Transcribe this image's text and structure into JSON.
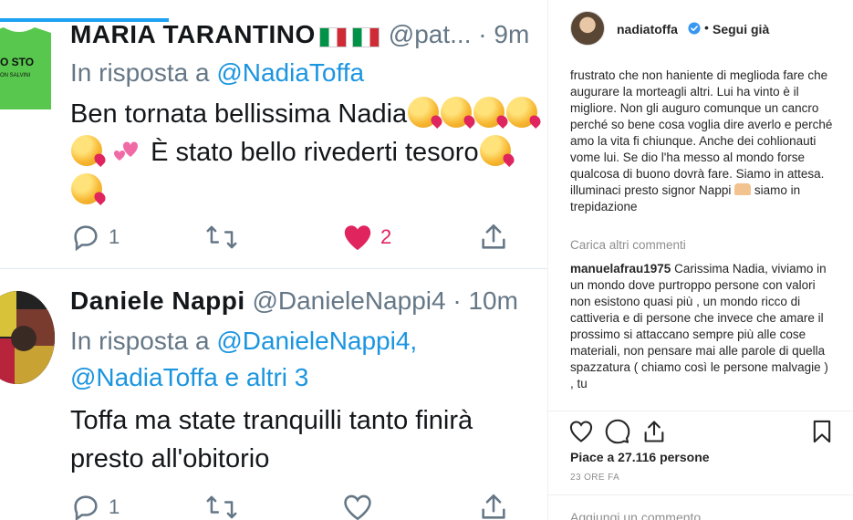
{
  "tweet_screenshot": {
    "tweet1": {
      "author_name": "MARIA TARANTINO",
      "author_handle": "@pat...",
      "time": "· 9m",
      "shirt_text": "O STO",
      "shirt_subtext": "ON SALVINI",
      "reply_prefix": "In risposta a",
      "reply_mention": "@NadiaToffa",
      "text_line1": "Ben tornata bellissima Nadia",
      "text_line2": "È stato bello rivederti tesoro",
      "replies": "1",
      "likes": "2"
    },
    "tweet2": {
      "author_name": "Daniele  Nappi",
      "author_handle": "@DanieleNappi4",
      "time": "· 10m",
      "reply_prefix": "In risposta a",
      "reply_mention1": "@DanieleNappi4,",
      "reply_mention2": "@NadiaToffa e altri 3",
      "text_line1": "Toffa ma state tranquilli  tanto finirà",
      "text_line2": "presto  all'obitorio",
      "replies": "1"
    }
  },
  "instagram": {
    "username": "nadiatoffa",
    "follow_status": "Segui già",
    "dot": "•",
    "comment_partial": "frustrato che non haniente di meglioda fare che augurare la morteagli altri. Lui ha vinto è il migliore. Non gli auguro comunque un cancro perché so bene cosa voglia dire averlo e perché amo la vita fi chiunque. Anche dei cohlionauti vome lui. Se dio l'ha messo al mondo forse qualcosa di buono dovrà fare. Siamo in attesa. illuminaci presto signor Nappi",
    "comment_partial_end": "siamo in trepidazione",
    "load_more": "Carica altri commenti",
    "comment2_user": "manuelafrau1975",
    "comment2_text": "Carissima Nadia, viviamo in un mondo dove purtroppo persone con valori non esistono quasi più , un mondo ricco di cattiveria e di persone che invece che amare il prossimo si attaccano sempre più alle cose materiali, non pensare mai alle parole di quella spazzatura ( chiamo così le persone malvagie ) , tu",
    "likes": "Piace a 27.116 persone",
    "time_ago": "23 ORE FA",
    "add_comment_placeholder": "Aggiungi un commento..."
  },
  "colors": {
    "twitter_blue": "#1b95e0",
    "twitter_gray": "#657786",
    "like_red": "#e0245e",
    "ig_text": "#262626",
    "ig_muted": "#8e8e8e",
    "verified_blue": "#3897f0"
  }
}
